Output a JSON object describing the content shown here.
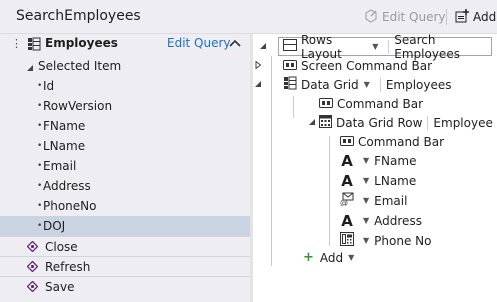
{
  "title_bar": {
    "title": "SearchEmployees",
    "edit_query_label": "Edit Query",
    "add_label": "Add"
  },
  "left_panel": {
    "header": {
      "title": "Employees",
      "edit_query_link": "Edit Query"
    },
    "selected_item_label": "Selected Item",
    "fields": [
      "Id",
      "RowVersion",
      "FName",
      "LName",
      "Email",
      "Address",
      "PhoneNo",
      "DOJ"
    ],
    "selected_field": "DOJ",
    "methods": [
      "Close",
      "Refresh",
      "Save"
    ]
  },
  "tree": {
    "root_layout": "Rows Layout",
    "root_name": "Search Employees",
    "screen_command_bar": "Screen Command Bar",
    "data_grid": {
      "type": "Data Grid",
      "source": "Employees"
    },
    "grid_command_bar": "Command Bar",
    "data_grid_row": {
      "type": "Data Grid Row",
      "source": "Employee"
    },
    "row_command_bar": "Command Bar",
    "row_fields": [
      {
        "label": "FName",
        "icon": "text-A-icon"
      },
      {
        "label": "LName",
        "icon": "text-A-icon"
      },
      {
        "label": "Email",
        "icon": "email-icon"
      },
      {
        "label": "Address",
        "icon": "text-A-icon"
      },
      {
        "label": "Phone No",
        "icon": "phone-icon"
      }
    ],
    "add_label": "Add"
  },
  "colors": {
    "panel_bg": "#eeeef2",
    "selected_row": "#c9d3e1",
    "link": "#1c6ec5",
    "method_icon": "#68217a",
    "add_plus": "#2e9a2e"
  }
}
